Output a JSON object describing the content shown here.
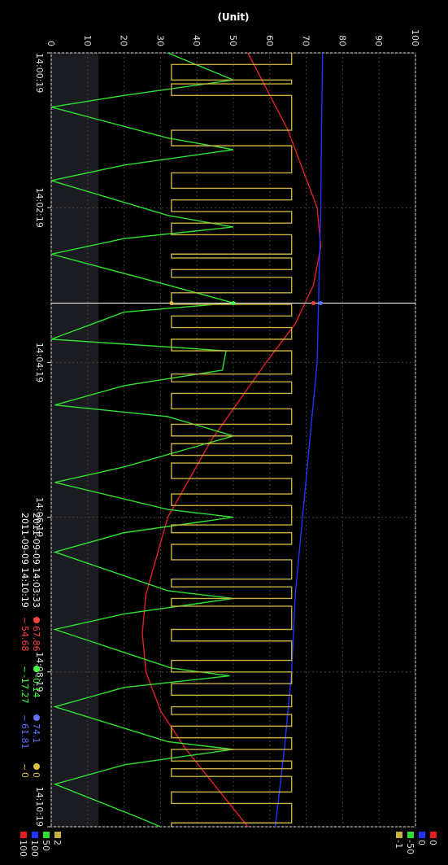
{
  "chart_data": {
    "type": "line",
    "ylabel": "(Unit)",
    "ylim": [
      0,
      100
    ],
    "y_ticks": [
      "0",
      "10",
      "20",
      "30",
      "40",
      "50",
      "60",
      "70",
      "80",
      "90",
      "100"
    ],
    "x_ticks": [
      "14:00:19",
      "14:02:19",
      "14:04:19",
      "14:06:19",
      "14:08:19",
      "14:10:19"
    ],
    "x_tick_minutes": [
      0,
      2,
      4,
      6,
      8,
      10
    ],
    "cursor_minute": 3.233,
    "grid": true,
    "series": [
      {
        "color": "#e02020",
        "x": [
          0,
          1,
          2,
          2.5,
          3,
          3.5,
          4,
          5,
          6,
          7,
          7.5,
          8,
          8.5,
          9,
          10
        ],
        "values": [
          54,
          65,
          73,
          74,
          72,
          67,
          59,
          44,
          32,
          26,
          25,
          26,
          30,
          37,
          54
        ]
      },
      {
        "color": "#2233ff",
        "x": [
          0,
          1,
          2,
          3,
          4,
          5,
          6,
          7,
          8,
          9,
          10
        ],
        "values": [
          74.5,
          74.2,
          74,
          73.5,
          73,
          71,
          69,
          67,
          66,
          64,
          61.5
        ]
      },
      {
        "color": "#30e030",
        "x": [
          0,
          0.35,
          0.55,
          0.7,
          1.1,
          1.25,
          1.45,
          1.65,
          2.1,
          2.25,
          2.4,
          2.6,
          3.0,
          3.23,
          3.35,
          3.7,
          3.85,
          4.1,
          4.3,
          4.55,
          4.7,
          4.95,
          5.35,
          5.55,
          5.9,
          6.0,
          6.2,
          6.45,
          6.95,
          7.05,
          7.25,
          7.45,
          7.95,
          8.05,
          8.2,
          8.45,
          8.9,
          9.0,
          9.2,
          9.45,
          9.9,
          10.0
        ],
        "values": [
          32,
          50,
          20,
          0,
          32,
          50,
          20,
          0,
          32,
          50,
          20,
          0,
          32,
          50,
          20,
          0,
          48,
          47,
          20,
          1,
          32,
          50,
          20,
          1,
          32,
          50,
          20,
          1,
          32,
          50,
          20,
          1,
          33,
          49,
          20,
          1,
          32,
          50,
          20,
          1,
          25,
          30
        ]
      },
      {
        "color": "#c8b040",
        "type": "step",
        "x": [
          0,
          0.15,
          0.35,
          0.4,
          0.55,
          1.0,
          1.2,
          1.55,
          1.75,
          1.9,
          2.05,
          2.2,
          2.35,
          2.6,
          2.65,
          2.8,
          2.9,
          3.1,
          3.25,
          3.4,
          3.55,
          3.7,
          3.85,
          4.15,
          4.25,
          4.4,
          4.6,
          4.8,
          4.95,
          5.05,
          5.2,
          5.3,
          5.5,
          5.7,
          5.85,
          6.1,
          6.2,
          6.35,
          6.55,
          6.8,
          6.9,
          7.05,
          7.15,
          7.45,
          7.6,
          7.85,
          8.0,
          8.15,
          8.3,
          8.45,
          8.55,
          8.7,
          8.85,
          9.0,
          9.15,
          9.25,
          9.35,
          9.55,
          9.7,
          9.95
        ],
        "values": [
          2,
          -1,
          2,
          -1,
          2,
          -1,
          2,
          -1,
          2,
          -1,
          2,
          -1,
          2,
          -1,
          2,
          -1,
          2,
          -1,
          2,
          -1,
          2,
          -1,
          2,
          -1,
          2,
          -1,
          2,
          -1,
          2,
          -1,
          2,
          -1,
          2,
          -1,
          2,
          -1,
          2,
          -1,
          2,
          -1,
          2,
          -1,
          2,
          -1,
          2,
          -1,
          2,
          -1,
          2,
          -1,
          2,
          -1,
          2,
          -1,
          2,
          -1,
          2,
          -1,
          2,
          -1
        ]
      }
    ],
    "secondary_axis_labels": [
      {
        "color": "#e02020",
        "top": "100",
        "bottom": "0"
      },
      {
        "color": "#2233ff",
        "top": "100",
        "bottom": "0"
      },
      {
        "color": "#30e030",
        "top": "50",
        "bottom": "-50"
      },
      {
        "color": "#c8b040",
        "top": "2",
        "bottom": "-1"
      }
    ]
  },
  "info": {
    "cursor_time": "2011-09-09 14:03:33",
    "end_time": "2011-09-09 14:10:19",
    "cursor_values": [
      {
        "color": "#ff4040",
        "text": "67.86"
      },
      {
        "color": "#40ff40",
        "text": "-0.14"
      },
      {
        "color": "#6070ff",
        "text": "74.1"
      },
      {
        "color": "#e0c040",
        "text": "0"
      }
    ],
    "end_values": [
      {
        "color": "#ff4040",
        "text": "54.68"
      },
      {
        "color": "#40ff40",
        "text": "-17.27"
      },
      {
        "color": "#6070ff",
        "text": "61.81"
      },
      {
        "color": "#e0c040",
        "text": "0"
      }
    ]
  }
}
